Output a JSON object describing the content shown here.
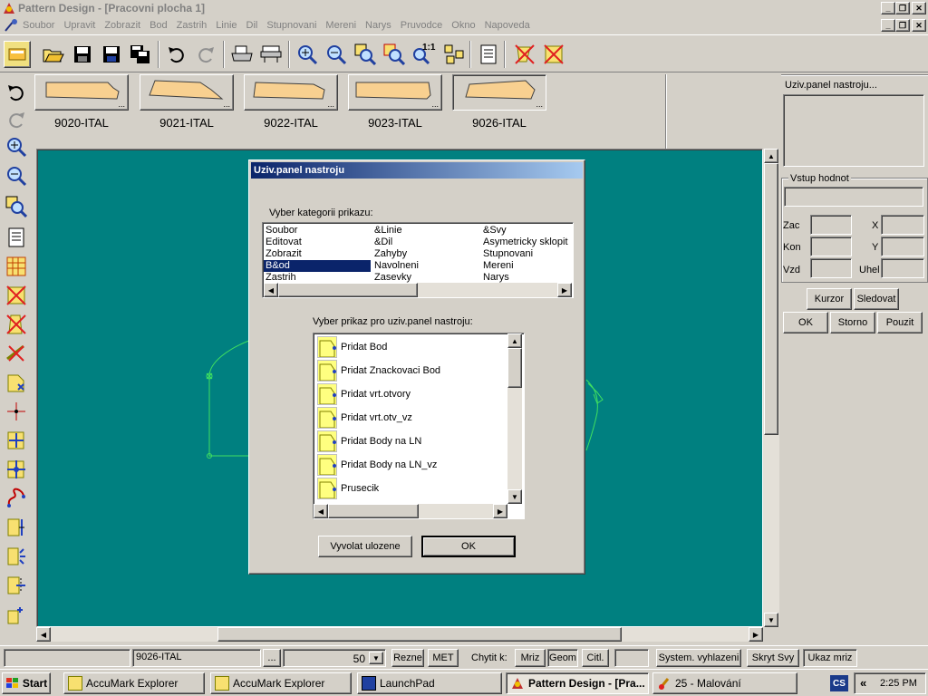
{
  "window": {
    "title": "Pattern Design - [Pracovni plocha 1]"
  },
  "menu": [
    "Soubor",
    "Upravit",
    "Zobrazit",
    "Bod",
    "Zastrih",
    "Linie",
    "Dil",
    "Stupnovani",
    "Mereni",
    "Narys",
    "Pruvodce",
    "Okno",
    "Napoveda"
  ],
  "toolbar": {
    "icons": [
      "layout-icon",
      "open-folder-icon",
      "save-icon",
      "save-as-icon",
      "save-all-icon",
      "undo-icon",
      "redo-icon",
      "print-icon",
      "plot-icon",
      "zoom-in-icon",
      "zoom-out-icon",
      "zoom-window-icon",
      "zoom-piece-icon",
      "zoom-full-icon",
      "arrange-icon",
      "notes-icon",
      "delete-piece-icon",
      "close-piece-icon"
    ],
    "zoom_label": "1:1"
  },
  "thumbnails": [
    "9020-ITAL",
    "9021-ITAL",
    "9022-ITAL",
    "9023-ITAL",
    "9026-ITAL"
  ],
  "dialog": {
    "title": "Uziv.panel nastroju",
    "category_label": "Vyber kategorii prikazu:",
    "categories": [
      [
        "Soubor",
        "&Linie",
        "&Svy"
      ],
      [
        "Editovat",
        "&Dil",
        "Asymetricky sklopit"
      ],
      [
        "Zobrazit",
        "Zahyby",
        "Stupnovani"
      ],
      [
        "B&od",
        "Navolneni",
        "Mereni"
      ],
      [
        "Zastrih",
        "Zasevky",
        "Narys"
      ]
    ],
    "command_label": "Vyber prikaz pro uziv.panel nastroju:",
    "commands": [
      "Pridat Bod",
      "Pridat Znackovaci Bod",
      "Pridat vrt.otvory",
      "Pridat vrt.otv_vz",
      "Pridat Body na LN",
      "Pridat Body na LN_vz",
      "Prusecik"
    ],
    "recall_button": "Vyvolat ulozene",
    "ok_button": "OK"
  },
  "right_panel": {
    "title": "Uziv.panel nastroju...",
    "input_group": "Vstup hodnot",
    "labels": {
      "zac": "Zac",
      "kon": "Kon",
      "vzd": "Vzd",
      "x": "X",
      "y": "Y",
      "uhel": "Uhel"
    },
    "buttons": {
      "kurzor": "Kurzor",
      "sledovat": "Sledovat",
      "ok": "OK",
      "storno": "Storno",
      "pouzit": "Pouzit"
    }
  },
  "statusbar": {
    "piece": "9026-ITAL",
    "more": "...",
    "value": "50",
    "rezne": "Rezne",
    "met": "MET",
    "chytit": "Chytit k:",
    "mriz": "Mriz",
    "geom": "Geom",
    "citl": "Citl.",
    "system": "System. vyhlazeni",
    "skryt": "Skryt Svy",
    "ukaz": "Ukaz mriz"
  },
  "taskbar": {
    "start": "Start",
    "tasks": [
      "AccuMark Explorer",
      "AccuMark Explorer",
      "LaunchPad",
      "Pattern Design - [Pra...",
      "25 - Malování"
    ],
    "lang": "CS",
    "arrows": "«",
    "time": "2:25 PM"
  }
}
